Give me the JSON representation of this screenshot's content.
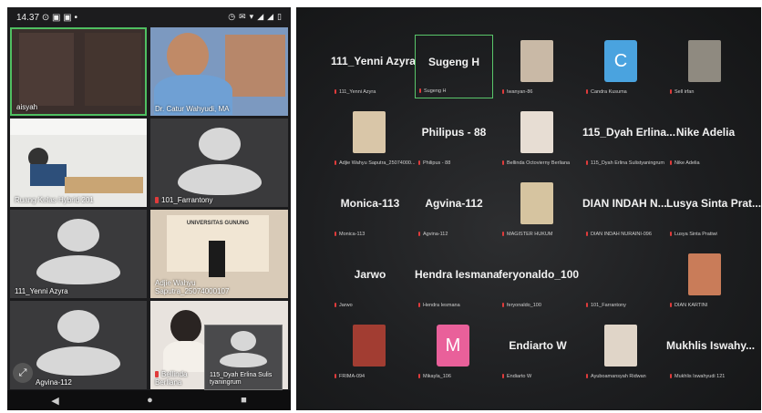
{
  "phone": {
    "status_time": "14.37",
    "status_icons": [
      "⊙",
      "▣",
      "▣",
      "•"
    ],
    "status_right": [
      "◷",
      "✉",
      "▾",
      "◢",
      "◢",
      "▯"
    ],
    "tiles": [
      {
        "name": "aisyah"
      },
      {
        "name": "Dr. Catur Wahyudi, MA"
      },
      {
        "name": "Ruang Kelas Hybrid 201"
      },
      {
        "name": "101_Farrantony"
      },
      {
        "name": "111_Yenni Azyra"
      },
      {
        "name": "Adjie Wahyu Saputra_25074000107"
      },
      {
        "name": "Agvina-112"
      },
      {
        "name": "Bellinda Berliana"
      },
      {
        "name": "115_Dyah Erlina Sulis tyaningrum"
      }
    ],
    "building_text": "UNIVERSITAS GUNUNG",
    "nav": [
      "◀",
      "●",
      "■"
    ],
    "fab_icon": "⤢"
  },
  "screen": {
    "cells": [
      {
        "big": "111_Yenni Azyra",
        "small": "111_Yenni Azyra"
      },
      {
        "big": "Sugeng H",
        "small": "Sugeng H"
      },
      {
        "big": "",
        "small": "Iwanyan-86"
      },
      {
        "big": "",
        "small": "Candra Kusuma",
        "letter": "C"
      },
      {
        "big": "",
        "small": "Sell irfan"
      },
      {
        "big": "",
        "small": "Adjie Wahyu Saputra_25074000..."
      },
      {
        "big": "Philipus - 88",
        "small": "Philipus - 88"
      },
      {
        "big": "",
        "small": "Bellinda Octovierny Berliana"
      },
      {
        "big": "115_Dyah Erlina...",
        "small": "115_Dyah Erlina Sulistyaningrum"
      },
      {
        "big": "Nike Adelia",
        "small": "Nike Adelia"
      },
      {
        "big": "Monica-113",
        "small": "Monica-113"
      },
      {
        "big": "Agvina-112",
        "small": "Agvina-112"
      },
      {
        "big": "",
        "small": "MAGISTER HUKUM"
      },
      {
        "big": "DIAN INDAH N...",
        "small": "DIAN INDAH NURAINI-096"
      },
      {
        "big": "Lusya Sinta Prat...",
        "small": "Lusya Sinta Pratiwi"
      },
      {
        "big": "Jarwo",
        "small": "Jarwo"
      },
      {
        "big": "Hendra Iesmana",
        "small": "Hendra Iesmana"
      },
      {
        "big": "feryonaldo_100",
        "small": "feryonaldo_100"
      },
      {
        "big": "",
        "small": "101_Farrantony"
      },
      {
        "big": "",
        "small": "DIAN KARTINI"
      },
      {
        "big": "",
        "small": "FRIMA-094"
      },
      {
        "big": "",
        "small": "Mikayla_106",
        "letter": "M"
      },
      {
        "big": "Endiarto W",
        "small": "Endiarto W"
      },
      {
        "big": "",
        "small": "Ayuboamansyah Ridwan"
      },
      {
        "big": "Mukhlis Iswahy...",
        "small": "Mukhlis Iswahyudi 121"
      }
    ],
    "colors": {
      "candra": "#4aa3df",
      "mikayla": "#e9609a",
      "active_border": "#4fbf61"
    }
  }
}
